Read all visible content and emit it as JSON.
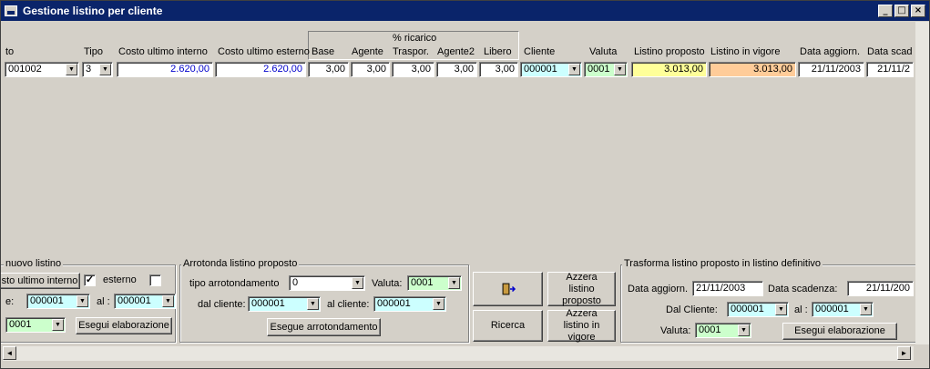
{
  "window": {
    "title": "Gestione listino per cliente",
    "btn_min": "_",
    "btn_max": "□",
    "btn_close": "×"
  },
  "colors": {
    "titlebar": "#0a246a",
    "cyan_field": "#ccffff",
    "green_field": "#ccffcc",
    "yellow_field": "#ffff99",
    "orange_field": "#ffcc99"
  },
  "grid": {
    "ricarico_label": "% ricarico",
    "headers": {
      "articolo": "to",
      "tipo": "Tipo",
      "costo_int": "Costo ultimo interno",
      "costo_est": "Costo ultimo esterno",
      "base": "Base",
      "agente": "Agente",
      "traspor": "Traspor.",
      "agente2": "Agente2",
      "libero": "Libero",
      "cliente": "Cliente",
      "valuta": "Valuta",
      "listino_proposto": "Listino proposto",
      "listino_vigore": "Listino in vigore",
      "data_aggiorn": "Data aggiorn.",
      "data_scad": "Data scad"
    },
    "row": {
      "articolo": "001002",
      "tipo": "3",
      "costo_int": "2.620,00",
      "costo_est": "2.620,00",
      "base": "3,00",
      "agente": "3,00",
      "traspor": "3,00",
      "agente2": "3,00",
      "libero": "3,00",
      "cliente": "000001",
      "valuta": "0001",
      "listino_proposto": "3.013,00",
      "listino_vigore": "3.013,00",
      "data_aggiorn": "21/11/2003",
      "data_scad": "21/11/2"
    }
  },
  "nuovo": {
    "group_label": "nuovo listino",
    "btn_costo_interno": "sto ultimo interno",
    "chk1": "✓",
    "lbl_esterno": "esterno",
    "lbl_da": "e:",
    "da_value": "000001",
    "lbl_al": "al :",
    "al_value": "000001",
    "valuta_value": "0001",
    "btn_esegui": "Esegui elaborazione"
  },
  "arrotonda": {
    "group_label": "Arrotonda listino proposto",
    "lbl_tipo": "tipo arrotondamento",
    "tipo_value": "0",
    "lbl_valuta": "Valuta:",
    "valuta_value": "0001",
    "lbl_dal": "dal cliente:",
    "dal_value": "000001",
    "lbl_al": "al cliente:",
    "al_value": "000001",
    "btn_esegue": "Esegue arrotondamento"
  },
  "center": {
    "exit_icon": "exit-door-icon",
    "btn_azzera_proposto": "Azzera listino proposto",
    "btn_ricerca": "Ricerca",
    "btn_azzera_vigore": "Azzera listino in vigore"
  },
  "trasforma": {
    "group_label": "Trasforma listino proposto in listino definitivo",
    "lbl_data_aggiorn": "Data aggiorn.",
    "data_aggiorn_value": "21/11/2003",
    "lbl_data_scad": "Data scadenza:",
    "data_scad_value": "21/11/200",
    "lbl_dal": "Dal Cliente:",
    "dal_value": "000001",
    "lbl_al": "al :",
    "al_value": "000001",
    "lbl_valuta": "Valuta:",
    "valuta_value": "0001",
    "btn_esegui": "Esegui elaborazione"
  },
  "scroll": {
    "left": "◄",
    "right": "►"
  }
}
